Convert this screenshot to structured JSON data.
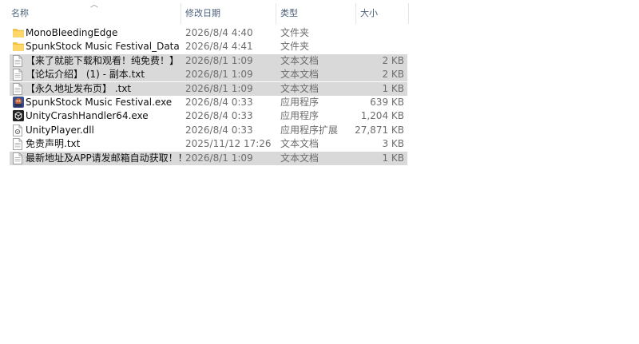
{
  "columns": {
    "name": "名称",
    "date": "修改日期",
    "type": "类型",
    "size": "大小"
  },
  "files": [
    {
      "name": "MonoBleedingEdge",
      "date": "2026/8/4 4:40",
      "type": "文件夹",
      "size": "",
      "icon": "folder-icon",
      "selected": false
    },
    {
      "name": "SpunkStock Music Festival_Data",
      "date": "2026/8/4 4:41",
      "type": "文件夹",
      "size": "",
      "icon": "folder-icon",
      "selected": false
    },
    {
      "name": "【来了就能下载和观看！纯免费！】 - 副...",
      "date": "2026/8/1 1:09",
      "type": "文本文档",
      "size": "2 KB",
      "icon": "text-file-icon",
      "selected": true
    },
    {
      "name": "【论坛介绍】 (1) - 副本.txt",
      "date": "2026/8/1 1:09",
      "type": "文本文档",
      "size": "2 KB",
      "icon": "text-file-icon",
      "selected": true
    },
    {
      "name": "【永久地址发布页】 .txt",
      "date": "2026/8/1 1:09",
      "type": "文本文档",
      "size": "1 KB",
      "icon": "text-file-icon",
      "selected": true
    },
    {
      "name": "SpunkStock Music Festival.exe",
      "date": "2026/8/4 0:33",
      "type": "应用程序",
      "size": "639 KB",
      "icon": "game-exe-icon",
      "selected": false
    },
    {
      "name": "UnityCrashHandler64.exe",
      "date": "2026/8/4 0:33",
      "type": "应用程序",
      "size": "1,204 KB",
      "icon": "unity-exe-icon",
      "selected": false
    },
    {
      "name": "UnityPlayer.dll",
      "date": "2026/8/4 0:33",
      "type": "应用程序扩展",
      "size": "27,871 KB",
      "icon": "dll-file-icon",
      "selected": false
    },
    {
      "name": "免责声明.txt",
      "date": "2025/11/12 17:26",
      "type": "文本文档",
      "size": "3 KB",
      "icon": "text-file-icon",
      "selected": false
    },
    {
      "name": "最新地址及APP请发邮箱自动获取！！！...",
      "date": "2026/8/1 1:09",
      "type": "文本文档",
      "size": "1 KB",
      "icon": "text-file-icon",
      "selected": true
    }
  ]
}
